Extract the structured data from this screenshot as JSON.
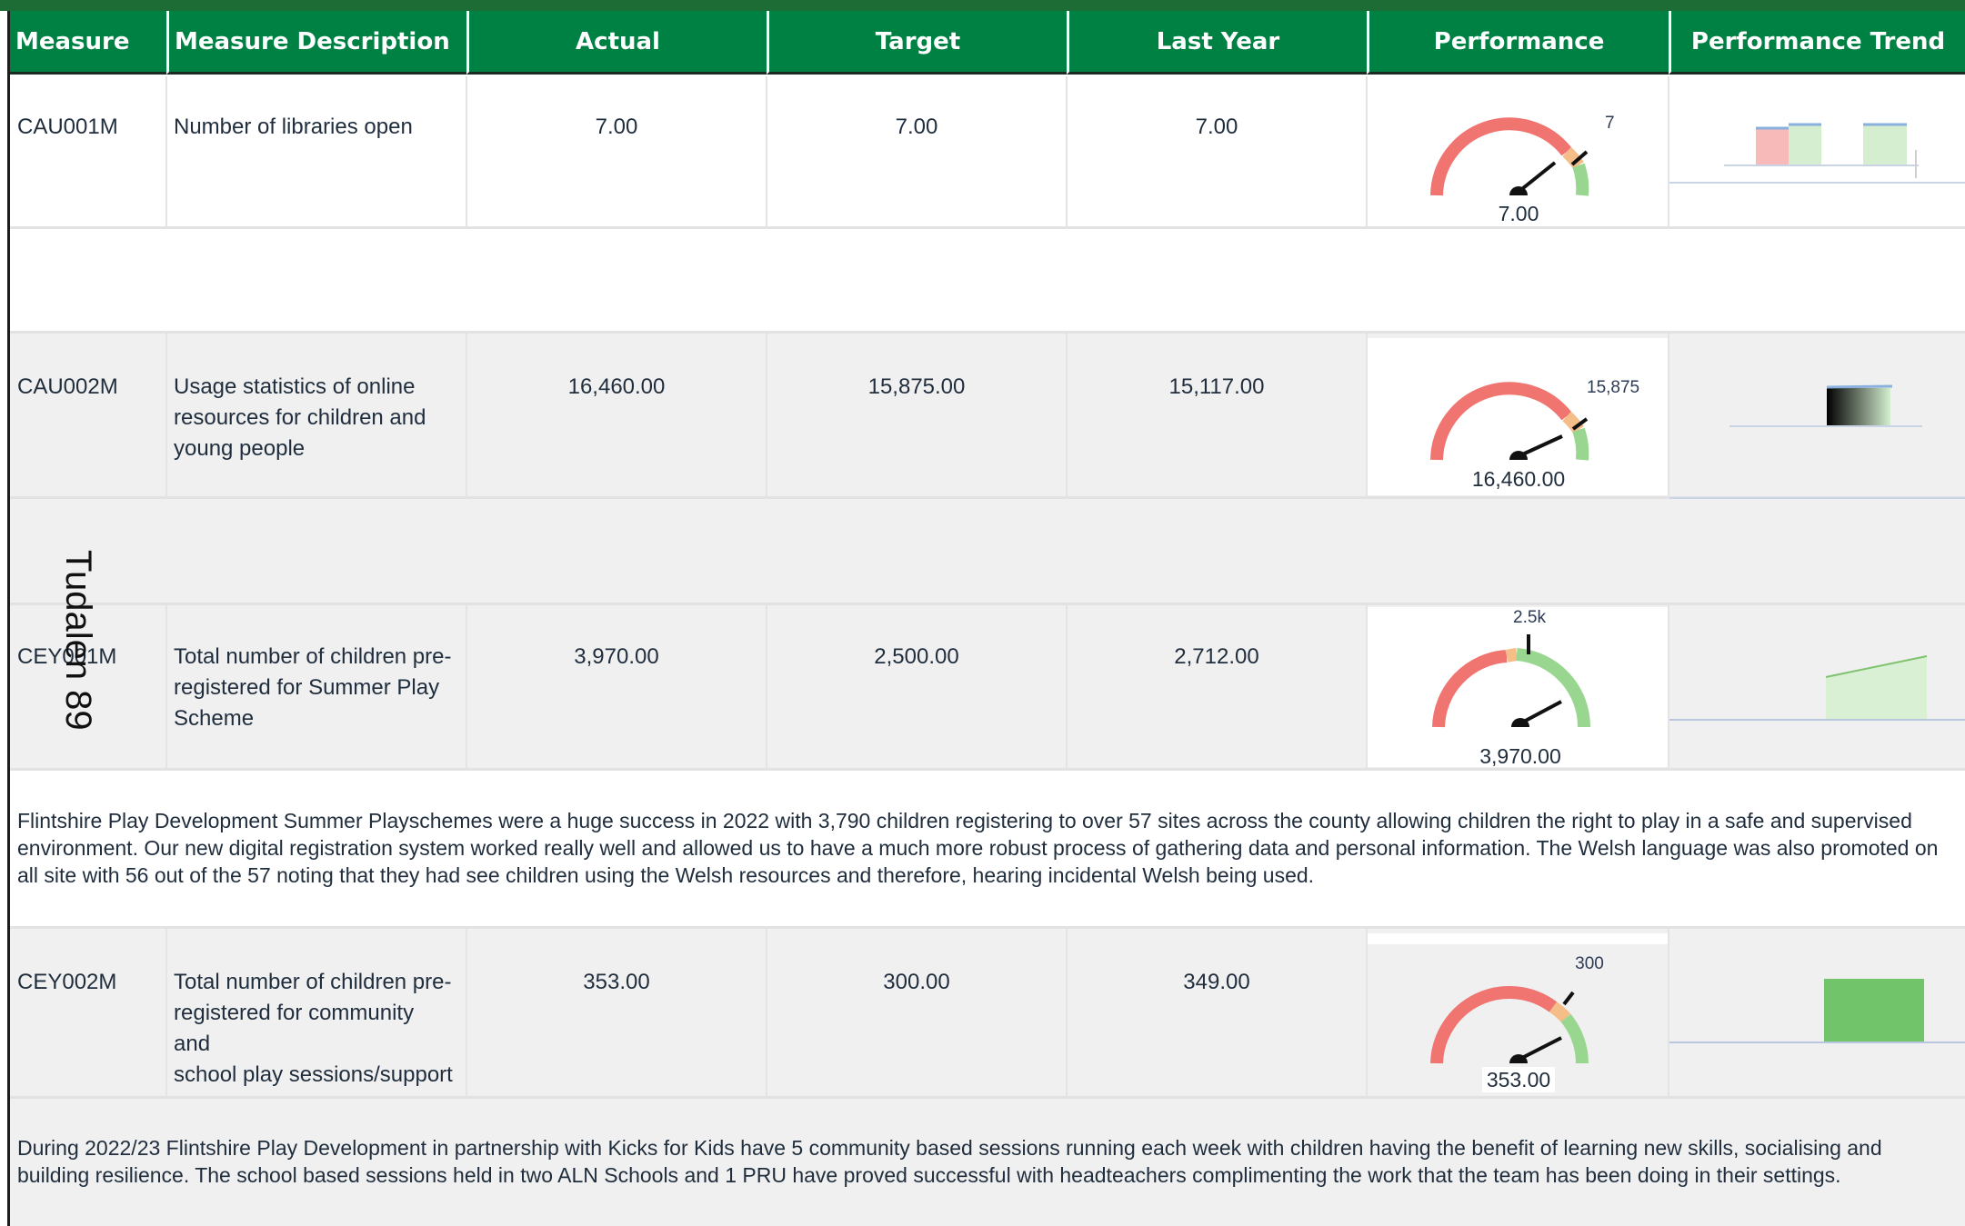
{
  "headers": {
    "measure": "Measure",
    "description": "Measure Description",
    "actual": "Actual",
    "target": "Target",
    "last_year": "Last Year",
    "performance": "Performance",
    "trend": "Performance Trend"
  },
  "side_label": "Tudalen 89",
  "rows": [
    {
      "code": "CAU001M",
      "description": [
        "Number of libraries open"
      ],
      "actual": "7.00",
      "target": "7.00",
      "last_year": "7.00",
      "gauge_value": "7.00",
      "gauge_target": "7",
      "colors": {
        "red": "#f07470",
        "amber": "#f5bd87",
        "green": "#99d68f"
      }
    },
    {
      "code": "CAU002M",
      "description": [
        "Usage statistics of online",
        "resources for children and",
        "young people"
      ],
      "actual": "16,460.00",
      "target": "15,875.00",
      "last_year": "15,117.00",
      "gauge_value": "16,460.00",
      "gauge_target": "15,875"
    },
    {
      "code": "CEY001M",
      "description": [
        "Total number of children pre-",
        "registered for Summer Play",
        "Scheme"
      ],
      "actual": "3,970.00",
      "target": "2,500.00",
      "last_year": "2,712.00",
      "gauge_value": "3,970.00",
      "gauge_target": "2.5k"
    },
    {
      "code": "CEY002M",
      "description": [
        "Total number of children pre-",
        "registered for community and",
        "school play sessions/support"
      ],
      "actual": "353.00",
      "target": "300.00",
      "last_year": "349.00",
      "gauge_value": "353.00",
      "gauge_target": "300"
    }
  ],
  "comments": [
    "Flintshire Play Development Summer Playschemes were a huge success in 2022 with 3,790 children registering to over 57 sites across the county allowing children the right to play in a safe and supervised environment. Our new digital registration system worked really well and allowed us to have a much more robust process of gathering data and personal information. The Welsh language was also promoted on all site with 56 out of the 57 noting that they had see children using the Welsh resources and therefore, hearing incidental Welsh being used.",
    "During 2022/23 Flintshire Play Development in partnership with Kicks for Kids have 5 community based sessions running each week with children having the benefit of learning new skills, socialising and building resilience. The school based sessions held in two ALN Schools and 1 PRU have proved successful with headteachers complimenting the work that the team has been doing in their settings."
  ],
  "colors": {
    "header_green": "#008144",
    "row_grey": "#f0f0f0",
    "gauge_red": "#f07470",
    "gauge_amber": "#f5bd87",
    "gauge_green": "#99d68f"
  }
}
